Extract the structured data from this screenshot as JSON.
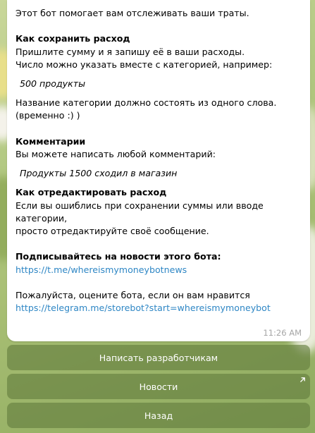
{
  "message": {
    "intro": "Этот бот помогает вам отслеживать ваши траты.",
    "section1_title": "Как сохранить расход",
    "section1_line1": "Пришлите сумму и я запишу её в ваши расходы.",
    "section1_line2": "Число можно указать вместе с категорией, например:",
    "example1": "500 продукты",
    "note_line1": "Название категории должно состоять из одного слова.",
    "note_line2": "(временно :) )",
    "section2_title": "Комментарии",
    "section2_line1": "Вы можете написать любой комментарий:",
    "example2": "Продукты 1500 сходил в магазин",
    "section3_title": "Как отредактировать расход",
    "section3_line1": "Если вы ошиблись при сохранении суммы или вводе категории,",
    "section3_line2": "просто отредактируйте своё сообщение.",
    "subscribe_title": "Подписывайтесь на новости этого бота:",
    "news_link": "https://t.me/whereismymoneybotnews",
    "rate_text": "Пожалуйста, оцените бота, если он вам нравится",
    "rate_link": "https://telegram.me/storebot?start=whereismymoneybot",
    "time": "11:26 AM"
  },
  "keyboard": {
    "btn_write_devs": "Написать разработчикам",
    "btn_news": "Новости",
    "btn_back": "Назад"
  },
  "colors": {
    "link": "#2f87c5",
    "button_bg": "rgba(98,125,62,0.62)"
  }
}
